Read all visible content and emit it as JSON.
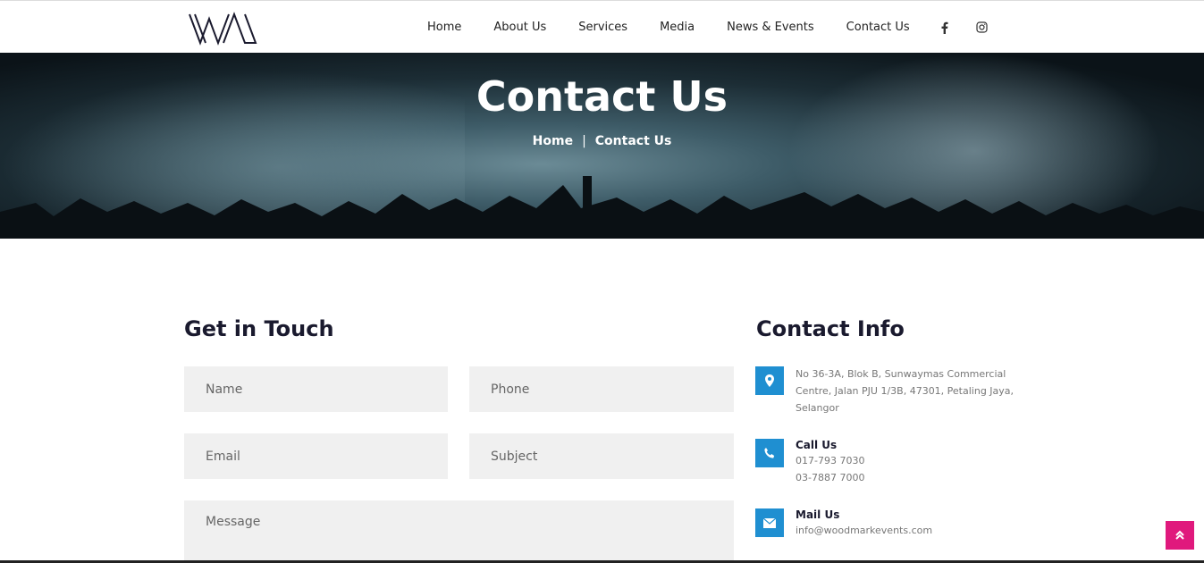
{
  "brand": {
    "logo_text": "WM"
  },
  "nav": {
    "items": [
      {
        "label": "Home"
      },
      {
        "label": "About Us"
      },
      {
        "label": "Services"
      },
      {
        "label": "Media"
      },
      {
        "label": "News & Events"
      },
      {
        "label": "Contact Us"
      }
    ],
    "social": [
      "facebook-icon",
      "instagram-icon"
    ]
  },
  "hero": {
    "title": "Contact Us",
    "breadcrumb": {
      "home": "Home",
      "separator": "|",
      "current": "Contact Us"
    }
  },
  "form": {
    "title": "Get in Touch",
    "name_placeholder": "Name",
    "phone_placeholder": "Phone",
    "email_placeholder": "Email",
    "subject_placeholder": "Subject",
    "message_placeholder": "Message"
  },
  "contact_info": {
    "title": "Contact Info",
    "address_lines": [
      "No 36-3A, Blok B, Sunwaymas Commercial",
      "Centre, Jalan PJU 1/3B, 47301, Petaling Jaya,",
      "Selangor"
    ],
    "call_heading": "Call Us",
    "phones": [
      "017-793 7030",
      "03-7887 7000"
    ],
    "mail_heading": "Mail Us",
    "email": "info@woodmarkevents.com"
  },
  "colors": {
    "accent_blue": "#1f8fd1",
    "scroll_top": "#e0197d",
    "heading": "#1a1a2e",
    "field_bg": "#f0f0f0"
  }
}
